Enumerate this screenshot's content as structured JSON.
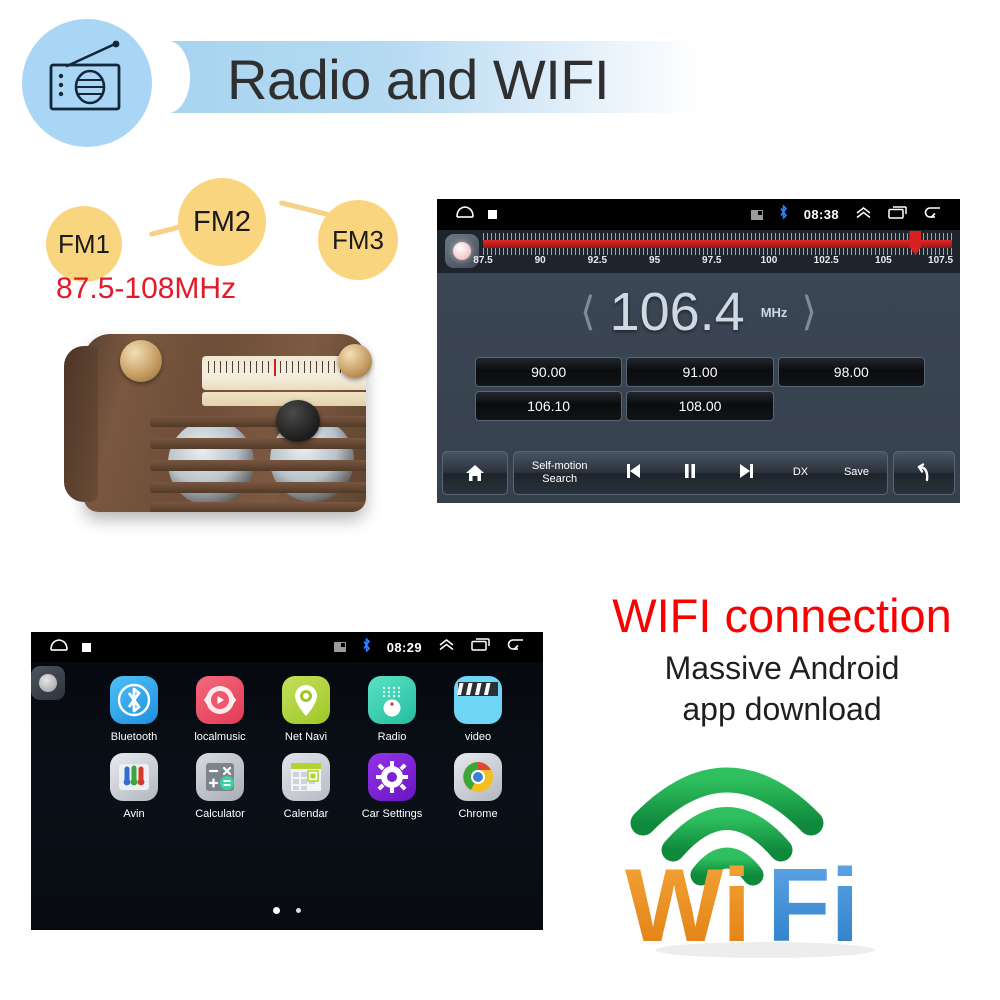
{
  "header": {
    "title": "Radio and WIFI",
    "icon": "radio-icon"
  },
  "fm": {
    "presets": [
      {
        "label": "FM1"
      },
      {
        "label": "FM2"
      },
      {
        "label": "FM3"
      }
    ],
    "range_label": "87.5-108MHz"
  },
  "vintage_radio": {
    "name": "vintage-radio-photo"
  },
  "radio_screen": {
    "statusbar": {
      "time": "08:38",
      "icons": [
        "home-icon",
        "stop-square-icon",
        "sd-card-icon",
        "bluetooth-icon",
        "chevron-up-icon",
        "recents-icon",
        "back-icon"
      ]
    },
    "tuner": {
      "scale_labels": [
        "87.5",
        "90",
        "92.5",
        "95",
        "97.5",
        "100",
        "102.5",
        "105",
        "107.5"
      ],
      "scale_min": 87.5,
      "scale_max": 108.0,
      "marker_value": 106.4,
      "bar_color": "#e02828"
    },
    "frequency": {
      "value": "106.4",
      "unit": "MHz",
      "prev_icon": "chevron-left-icon",
      "next_icon": "chevron-right-icon"
    },
    "presets": [
      "90.00",
      "91.00",
      "98.00",
      "106.10",
      "108.00",
      ""
    ],
    "toolbar": {
      "home_icon": "home-icon",
      "items": [
        {
          "label": "Self-motion\nSearch",
          "name": "self-motion-search-button"
        },
        {
          "label": "◀▌",
          "name": "prev-station-button"
        },
        {
          "label": "▌▌",
          "name": "pause-button"
        },
        {
          "label": "▌▶",
          "name": "next-station-button"
        },
        {
          "label": "DX",
          "name": "dx-button"
        },
        {
          "label": "Save",
          "name": "save-button"
        }
      ],
      "back_icon": "back-arrow-icon"
    }
  },
  "app_screen": {
    "statusbar": {
      "time": "08:29",
      "icons": [
        "home-icon",
        "stop-square-icon",
        "sd-card-icon",
        "bluetooth-icon",
        "chevron-up-icon",
        "recents-icon",
        "back-icon"
      ]
    },
    "apps": [
      {
        "label": "Bluetooth",
        "icon": "bluetooth-app-icon",
        "color": "#35a8ef"
      },
      {
        "label": "localmusic",
        "icon": "local-music-app-icon",
        "color": "#f0566b"
      },
      {
        "label": "Net Navi",
        "icon": "net-navi-app-icon",
        "color": "#b6d94c"
      },
      {
        "label": "Radio",
        "icon": "radio-app-icon",
        "color": "#42d6b6"
      },
      {
        "label": "video",
        "icon": "video-app-icon",
        "color": "#5ed0f5"
      },
      {
        "label": "Avin",
        "icon": "avin-app-icon",
        "color": "#c9ccd1"
      },
      {
        "label": "Calculator",
        "icon": "calculator-app-icon",
        "color": "#b9bcc2"
      },
      {
        "label": "Calendar",
        "icon": "calendar-app-icon",
        "color": "#c6c9ce"
      },
      {
        "label": "Car Settings",
        "icon": "car-settings-app-icon",
        "color": "#7b22d6"
      },
      {
        "label": "Chrome",
        "icon": "chrome-app-icon",
        "color": "#c9ccd1"
      }
    ],
    "pages": {
      "count": 2,
      "active": 1
    }
  },
  "wifi": {
    "title": "WIFI connection",
    "subtitle_line1": "Massive Android",
    "subtitle_line2": "app download",
    "logo_text_1": "Wi",
    "logo_text_2": "Fi",
    "logo_colors": {
      "wave": "#16a34a",
      "wi": "#ef8b1f",
      "fi": "#3c92dd"
    },
    "title_color": "#fc0000"
  }
}
